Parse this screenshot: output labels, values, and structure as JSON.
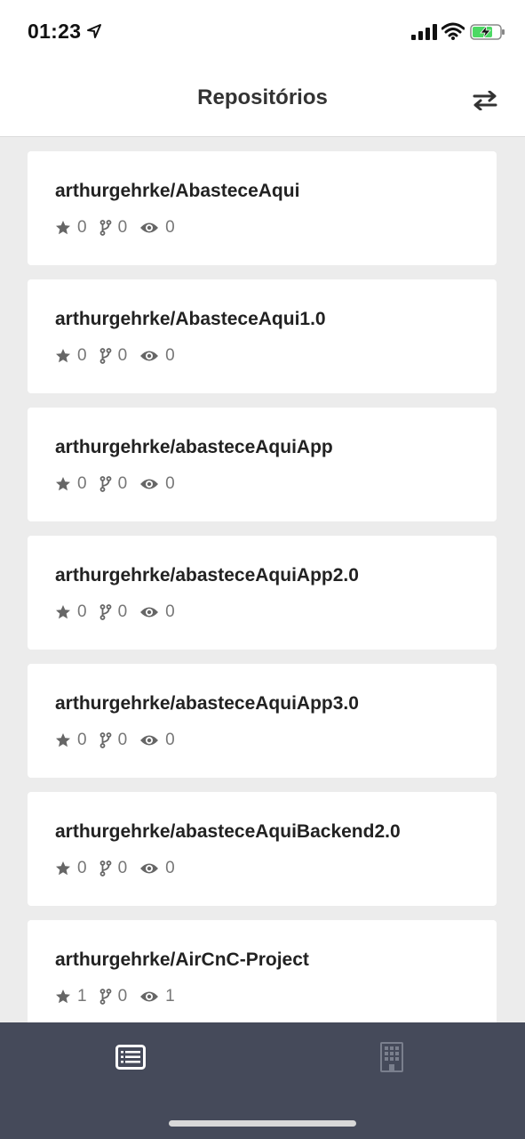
{
  "status_bar": {
    "time": "01:23",
    "icons": [
      "location-arrow-icon",
      "signal-icon",
      "wifi-icon",
      "battery-charging-icon"
    ]
  },
  "header": {
    "title": "Repositórios",
    "action_icon": "swap-arrows-icon"
  },
  "repositories": [
    {
      "name": "arthurgehrke/AbasteceAqui",
      "stars": "0",
      "forks": "0",
      "watchers": "0"
    },
    {
      "name": "arthurgehrke/AbasteceAqui1.0",
      "stars": "0",
      "forks": "0",
      "watchers": "0"
    },
    {
      "name": "arthurgehrke/abasteceAquiApp",
      "stars": "0",
      "forks": "0",
      "watchers": "0"
    },
    {
      "name": "arthurgehrke/abasteceAquiApp2.0",
      "stars": "0",
      "forks": "0",
      "watchers": "0"
    },
    {
      "name": "arthurgehrke/abasteceAquiApp3.0",
      "stars": "0",
      "forks": "0",
      "watchers": "0"
    },
    {
      "name": "arthurgehrke/abasteceAquiBackend2.0",
      "stars": "0",
      "forks": "0",
      "watchers": "0"
    },
    {
      "name": "arthurgehrke/AirCnC-Project",
      "stars": "1",
      "forks": "0",
      "watchers": "1"
    }
  ],
  "stat_icons": [
    "star-icon",
    "fork-icon",
    "eye-icon"
  ],
  "tab_bar": {
    "tabs": [
      {
        "icon": "list-alt-icon",
        "active": true
      },
      {
        "icon": "building-icon",
        "active": false
      }
    ]
  },
  "colors": {
    "background": "#ececec",
    "card": "#ffffff",
    "tab_bar": "#454a5a",
    "tab_active": "#ffffff",
    "tab_inactive": "#7a7f8d",
    "stat_icon": "#666666"
  }
}
